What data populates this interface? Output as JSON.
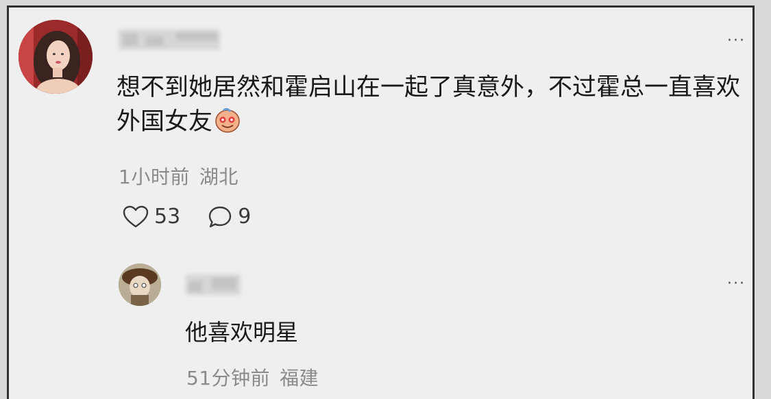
{
  "comment": {
    "text": "想不到她居然和霍启山在一起了真意外，不过霍总一直喜欢外国女友",
    "emoji": "grinning-face-emoji",
    "time": "1小时前",
    "location": "湖北",
    "like_count": "53",
    "reply_count": "9",
    "icons": {
      "like": "heart-icon",
      "reply": "speech-bubble-icon",
      "more": "more-dots-icon"
    }
  },
  "reply": {
    "text": "他喜欢明星",
    "time": "51分钟前",
    "location": "福建"
  },
  "more_label": "···",
  "colors": {
    "background": "#efefef",
    "text": "#1a1a1a",
    "meta": "#8a8a8a",
    "frame_border": "#303030"
  }
}
